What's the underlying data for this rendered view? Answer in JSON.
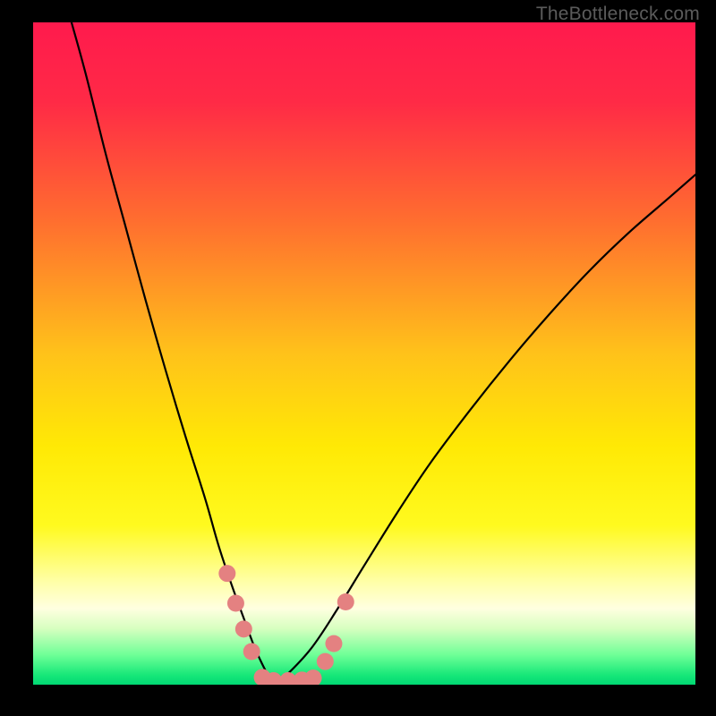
{
  "watermark": "TheBottleneck.com",
  "chart_data": {
    "type": "line",
    "title": "",
    "xlabel": "",
    "ylabel": "",
    "xlim": [
      0,
      100
    ],
    "ylim": [
      0,
      100
    ],
    "gradient_stops": [
      {
        "offset": 0.0,
        "color": "#ff1a4d"
      },
      {
        "offset": 0.12,
        "color": "#ff2a46"
      },
      {
        "offset": 0.3,
        "color": "#ff6e2f"
      },
      {
        "offset": 0.5,
        "color": "#ffc21a"
      },
      {
        "offset": 0.64,
        "color": "#ffe905"
      },
      {
        "offset": 0.76,
        "color": "#fffa1f"
      },
      {
        "offset": 0.845,
        "color": "#ffffa8"
      },
      {
        "offset": 0.885,
        "color": "#ffffe0"
      },
      {
        "offset": 0.915,
        "color": "#d7ffc0"
      },
      {
        "offset": 0.955,
        "color": "#6fff97"
      },
      {
        "offset": 0.985,
        "color": "#18e879"
      },
      {
        "offset": 1.0,
        "color": "#00d873"
      }
    ],
    "series": [
      {
        "name": "left-branch",
        "x": [
          5.8,
          8,
          11,
          14,
          17,
          20,
          23,
          26,
          28,
          30,
          32,
          33.5,
          35,
          36.3
        ],
        "y": [
          100,
          92,
          80,
          69,
          58,
          47.5,
          37.5,
          28,
          21,
          15,
          9.5,
          5.5,
          2.3,
          0
        ]
      },
      {
        "name": "right-branch",
        "x": [
          36.3,
          38,
          42,
          46,
          50,
          55,
          60,
          66,
          72,
          78,
          84,
          90,
          96,
          100
        ],
        "y": [
          0,
          1.2,
          5.5,
          11.5,
          18,
          26,
          33.5,
          41.5,
          49,
          56,
          62.5,
          68.3,
          73.5,
          77
        ]
      }
    ],
    "markers": {
      "name": "highlight-dots",
      "color": "#e48181",
      "radius_px": 9.5,
      "points": [
        {
          "x": 29.3,
          "y": 16.8
        },
        {
          "x": 30.6,
          "y": 12.3
        },
        {
          "x": 31.8,
          "y": 8.4
        },
        {
          "x": 33.0,
          "y": 5.0
        },
        {
          "x": 34.6,
          "y": 1.1
        },
        {
          "x": 36.3,
          "y": 0.6
        },
        {
          "x": 38.5,
          "y": 0.6
        },
        {
          "x": 40.6,
          "y": 0.7
        },
        {
          "x": 42.3,
          "y": 1.0
        },
        {
          "x": 44.1,
          "y": 3.5
        },
        {
          "x": 45.4,
          "y": 6.2
        },
        {
          "x": 47.2,
          "y": 12.5
        }
      ]
    }
  }
}
